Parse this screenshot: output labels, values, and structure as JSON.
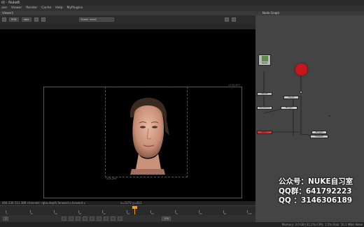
{
  "window": {
    "title": "d) - Nuke8"
  },
  "menubar": {
    "items": [
      "ase",
      "Viewer",
      "Render",
      "Cache",
      "Help",
      "MyPlugins"
    ]
  },
  "viewer": {
    "tab_label": "Viewer1",
    "channels_value": "RGB",
    "channel_sub": "rgba",
    "zoom_value": "Scant: rube1",
    "format_top_label": "1152,873",
    "bbox_label": "406,299",
    "status_text": "404 230 511 389 channels: rgba,depth,forward.u,forward.v",
    "coords_text": "x=1272 y=411",
    "frame_left": "1",
    "frame_right": "100"
  },
  "timeline": {
    "ticks": [
      "1",
      "10",
      "20",
      "30",
      "40",
      "50",
      "60",
      "70",
      "80",
      "90",
      "100"
    ]
  },
  "nodegraph": {
    "tab_label": "Node Graph",
    "nodes": [
      {
        "label": "Read6",
        "color": "#b8b8b8"
      },
      {
        "label": "Read1",
        "color": "#b8b8b8"
      },
      {
        "label": "Transform1",
        "color": "#c9c9c9"
      },
      {
        "label": "Merge1",
        "color": "#c9c9c9"
      },
      {
        "label": "Roto1",
        "color": "#c9c9c9"
      },
      {
        "label": "Copy1",
        "color": "#c9c9c9"
      },
      {
        "label": "Merge2",
        "color": "#c9c9c9"
      },
      {
        "label": "Viewer1",
        "color": "#c9c9c9"
      }
    ],
    "viewer_dot_color": "#c8161e"
  },
  "watermark": {
    "line1": "公众号：NUKE自习室",
    "line2": "QQ群：641792223",
    "line3": "QQ ：3146306189"
  },
  "statusbar": {
    "text": "Memory: 3.0 GB (31.2%)  CPU: 1.5%  Disk: 16.1 MB/s  Netw"
  }
}
